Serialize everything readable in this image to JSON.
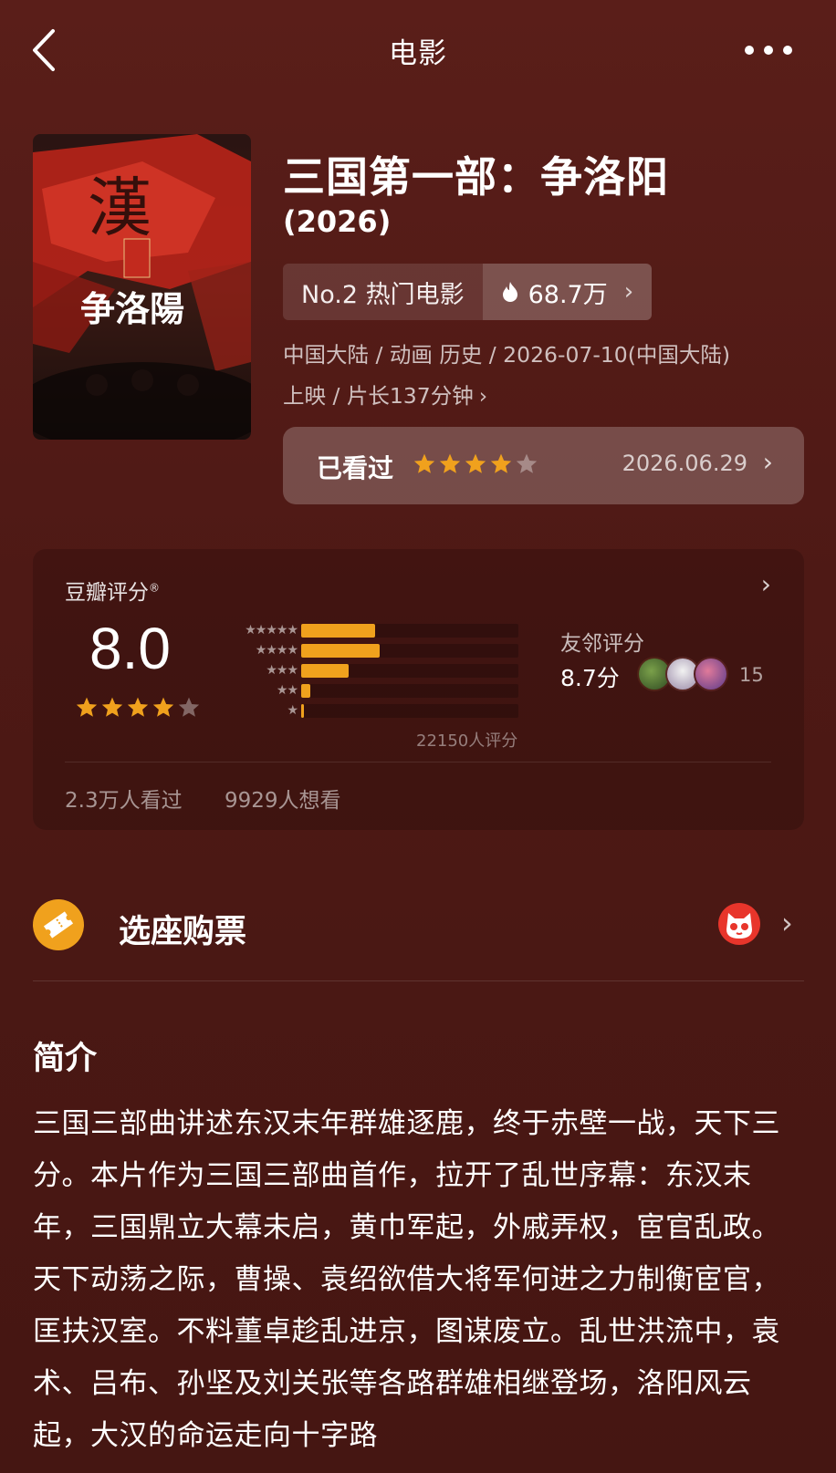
{
  "header": {
    "title": "电影"
  },
  "movie": {
    "title": "三国第一部：争洛阳",
    "year": "(2026)",
    "rank_label": "No.2 热门电影",
    "heat_value": "68.7万",
    "meta_line1": "中国大陆 / 动画 历史 / 2026-07-10(中国大陆)",
    "meta_line2": "上映 / 片长137分钟",
    "poster_alt": "争洛阳"
  },
  "watched": {
    "label": "已看过",
    "stars": 4,
    "date": "2026.06.29"
  },
  "rating": {
    "source_label": "豆瓣评分",
    "score": "8.0",
    "stars": 4,
    "count_label": "22150人评分",
    "distribution": [
      {
        "stars": 5,
        "fraction": 0.34
      },
      {
        "stars": 4,
        "fraction": 0.36
      },
      {
        "stars": 3,
        "fraction": 0.22
      },
      {
        "stars": 2,
        "fraction": 0.04
      },
      {
        "stars": 1,
        "fraction": 0.01
      }
    ],
    "friends_label": "友邻评分",
    "friends_score": "8.7分",
    "friends_count": "15",
    "seen_label": "2.3万人看过",
    "want_label": "9929人想看"
  },
  "tickets": {
    "label": "选座购票"
  },
  "synopsis": {
    "heading": "简介",
    "text": "三国三部曲讲述东汉末年群雄逐鹿，终于赤壁一战，天下三分。本片作为三国三部曲首作，拉开了乱世序幕：东汉末年，三国鼎立大幕未启，黄巾军起，外戚弄权，宦官乱政。天下动荡之际，曹操、袁绍欲借大将军何进之力制衡宦官，匡扶汉室。不料董卓趁乱进京，图谋废立。乱世洪流中，袁术、吕布、孙坚及刘关张等各路群雄相继登场，洛阳风云起，大汉的命运走向十字路"
  },
  "colors": {
    "background": "#4e1915",
    "accent_star": "#f0a11d",
    "bar_fill": "#f0a11d"
  }
}
